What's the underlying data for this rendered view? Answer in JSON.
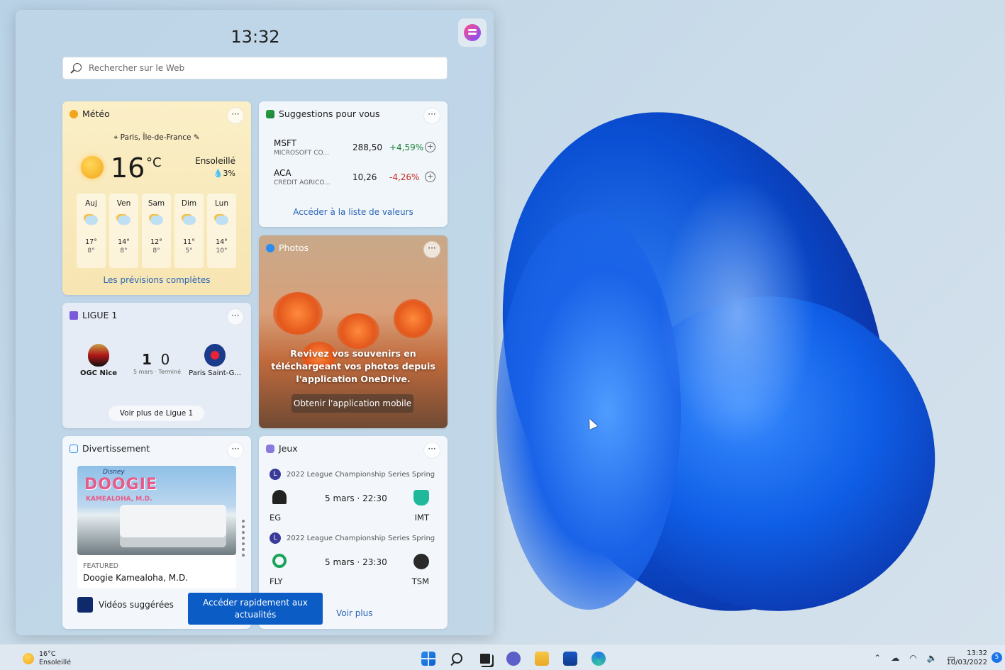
{
  "panel": {
    "time": "13:32",
    "search_placeholder": "Rechercher sur le Web"
  },
  "weather": {
    "title": "Météo",
    "location": "Paris, Île-de-France",
    "temperature": "16",
    "unit": "°C",
    "condition": "Ensoleillé",
    "precip": "3%",
    "forecast": [
      {
        "day": "Auj",
        "hi": "17°",
        "lo": "8°"
      },
      {
        "day": "Ven",
        "hi": "14°",
        "lo": "8°"
      },
      {
        "day": "Sam",
        "hi": "12°",
        "lo": "8°"
      },
      {
        "day": "Dim",
        "hi": "11°",
        "lo": "5°"
      },
      {
        "day": "Lun",
        "hi": "14°",
        "lo": "10°"
      }
    ],
    "link": "Les prévisions complètes"
  },
  "stocks": {
    "title": "Suggestions pour vous",
    "items": [
      {
        "symbol": "MSFT",
        "name": "MICROSOFT CO...",
        "value": "288,50",
        "change": "+4,59%",
        "color": "#1a7f37"
      },
      {
        "symbol": "ACA",
        "name": "CREDIT AGRICO...",
        "value": "10,26",
        "change": "-4,26%",
        "color": "#c42b1c"
      }
    ],
    "link": "Accéder à la liste de valeurs"
  },
  "photos": {
    "title": "Photos",
    "message": "Revivez vos souvenirs en téléchargeant vos photos depuis l'application OneDrive.",
    "button": "Obtenir l'application mobile"
  },
  "ligue": {
    "title": "LIGUE 1",
    "home": "OGC Nice",
    "away": "Paris Saint-G...",
    "home_score": "1",
    "away_score": "0",
    "date": "5 mars · Terminé",
    "button": "Voir plus de Ligue 1"
  },
  "divert": {
    "title": "Divertissement",
    "poster_title": "DOOGIE",
    "poster_sub": "KAMEALOHA, M.D.",
    "poster_brand": "Disney",
    "featured_label": "FEATURED",
    "featured_title": "Doogie Kamealoha, M.D.",
    "videos": "Vidéos suggérées"
  },
  "jeux": {
    "title": "Jeux",
    "matches": [
      {
        "league": "2022 League Championship Series Spring",
        "time": "5 mars · 22:30",
        "team1": "EG",
        "team2": "IMT"
      },
      {
        "league": "2022 League Championship Series Spring",
        "time": "5 mars · 23:30",
        "team1": "FLY",
        "team2": "TSM"
      }
    ],
    "link": "Voir plus"
  },
  "tooltip": "Accéder rapidement aux actualités",
  "taskbar": {
    "weather_temp": "16°C",
    "weather_cond": "Ensoleillé",
    "time": "13:32",
    "date": "10/03/2022",
    "notifications": "5"
  }
}
